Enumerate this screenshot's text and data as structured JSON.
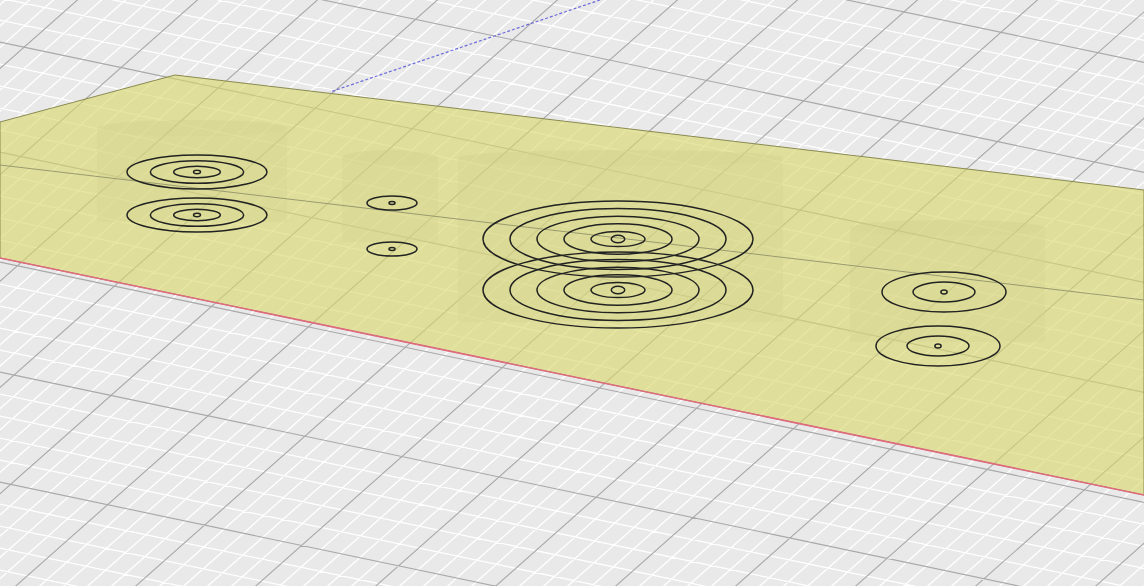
{
  "viewport": {
    "objects": [
      {
        "kind": "three-ring"
      },
      {
        "kind": "one-ring"
      },
      {
        "kind": "five-ring"
      },
      {
        "kind": "two-ring"
      }
    ]
  }
}
